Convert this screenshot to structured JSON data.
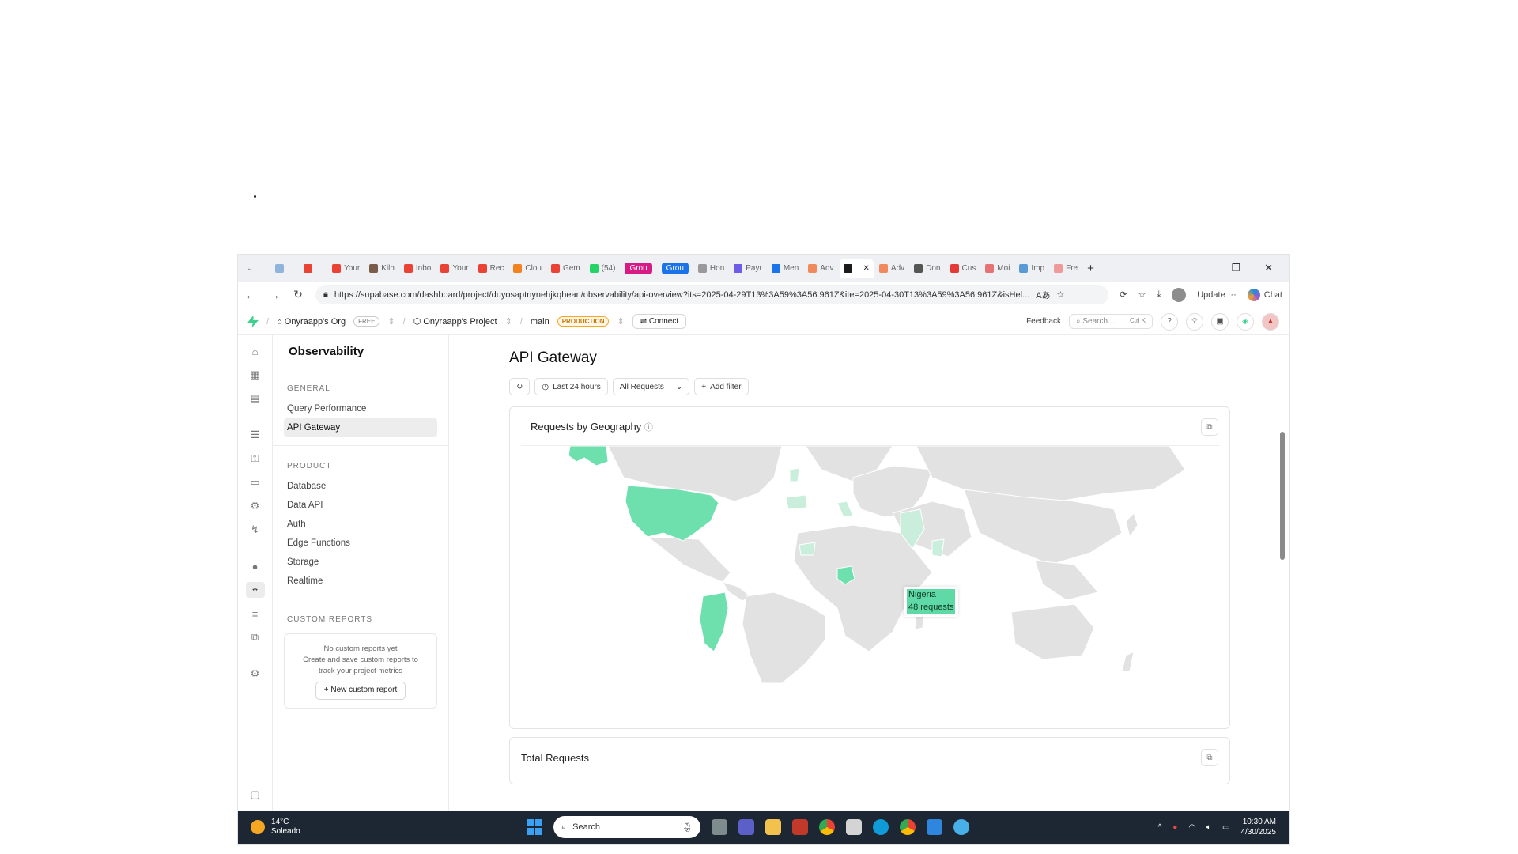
{
  "browser": {
    "tabs": [
      {
        "label": "",
        "color": "#8fb3d9"
      },
      {
        "label": "",
        "color": "#ea4335"
      },
      {
        "label": "Your",
        "color": "#ea4335"
      },
      {
        "label": "Kilh",
        "color": "#7a5c4a"
      },
      {
        "label": "Inbo",
        "color": "#ea4335"
      },
      {
        "label": "Your",
        "color": "#ea4335"
      },
      {
        "label": "Rec",
        "color": "#ea4335"
      },
      {
        "label": "Clou",
        "color": "#f48120"
      },
      {
        "label": "Gem",
        "color": "#ea4335"
      },
      {
        "label": "(54)",
        "color": "#25d366"
      }
    ],
    "pill_tabs": [
      {
        "label": "Grou",
        "color": "#d81b84"
      },
      {
        "label": "Grou",
        "color": "#1a73e8"
      }
    ],
    "tabs2": [
      {
        "label": "Hon",
        "color": "#999999"
      },
      {
        "label": "Payr",
        "color": "#6c5ce7"
      },
      {
        "label": "Men",
        "color": "#1a73e8"
      },
      {
        "label": "Adv",
        "color": "#f08a5d"
      }
    ],
    "active_tab_color": "#1c1c1c",
    "tabs3": [
      {
        "label": "Adv",
        "color": "#f08a5d"
      },
      {
        "label": "Don",
        "color": "#555555"
      },
      {
        "label": "Cus",
        "color": "#e53935"
      },
      {
        "label": "Moi",
        "color": "#e57373"
      },
      {
        "label": "Imp",
        "color": "#5b9bd5"
      },
      {
        "label": "Fre",
        "color": "#ef9a9a"
      }
    ],
    "url": "https://supabase.com/dashboard/project/duyosaptnynehjkqhean/observability/api-overview?its=2025-04-29T13%3A59%3A56.961Z&ite=2025-04-30T13%3A59%3A56.961Z&isHel...",
    "update_label": "Update",
    "chat_label": "Chat"
  },
  "header": {
    "org": "Onyraapp's Org",
    "org_badge": "FREE",
    "project": "Onyraapp's Project",
    "branch": "main",
    "branch_badge": "PRODUCTION",
    "connect": "Connect",
    "feedback": "Feedback",
    "search_placeholder": "Search...",
    "search_shortcut": "Ctrl K"
  },
  "sidebar": {
    "title": "Observability",
    "general_title": "GENERAL",
    "general": [
      {
        "label": "Query Performance"
      },
      {
        "label": "API Gateway"
      }
    ],
    "product_title": "PRODUCT",
    "product": [
      {
        "label": "Database"
      },
      {
        "label": "Data API"
      },
      {
        "label": "Auth"
      },
      {
        "label": "Edge Functions"
      },
      {
        "label": "Storage"
      },
      {
        "label": "Realtime"
      }
    ],
    "custom_title": "CUSTOM REPORTS",
    "custom_empty_title": "No custom reports yet",
    "custom_empty_desc": "Create and save custom reports to track your project metrics",
    "new_report": "New custom report"
  },
  "main": {
    "title": "API Gateway",
    "filter_time": "Last 24 hours",
    "filter_requests": "All Requests",
    "add_filter": "Add filter",
    "geo_card_title": "Requests by Geography",
    "tooltip_country": "Nigeria",
    "tooltip_value": "48 requests",
    "total_card_title": "Total Requests",
    "highlight_color": "#6ee0ae",
    "land_color": "#e2e2e2"
  },
  "taskbar": {
    "temp": "14°C",
    "weather": "Soleado",
    "search": "Search",
    "time": "10:30 AM",
    "date": "4/30/2025"
  }
}
